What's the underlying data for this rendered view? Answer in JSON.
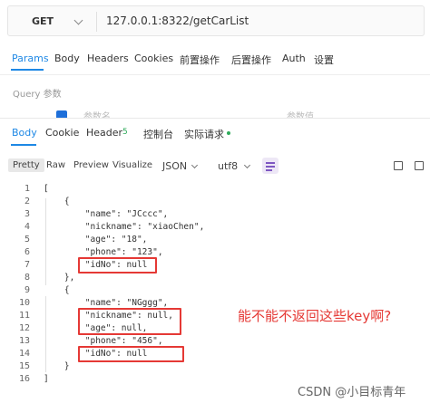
{
  "request": {
    "method": "GET",
    "url": "127.0.0.1:8322/getCarList"
  },
  "request_tabs": [
    "Params",
    "Body",
    "Headers",
    "Cookies",
    "前置操作",
    "后置操作",
    "Auth",
    "设置"
  ],
  "query_label": "Query 参数",
  "params_placeholders": {
    "name": "参数名",
    "value": "参数值"
  },
  "response_tabs": {
    "body": "Body",
    "cookie": "Cookie",
    "header": "Header",
    "header_count": "5",
    "console": "控制台",
    "actual_request": "实际请求"
  },
  "toolbar": {
    "pretty": "Pretty",
    "raw": "Raw",
    "preview": "Preview",
    "visualize": "Visualize",
    "format": "JSON",
    "encoding": "utf8"
  },
  "code_lines": [
    "[",
    "    {",
    "        \"name\": \"JCccc\",",
    "        \"nickname\": \"xiaoChen\",",
    "        \"age\": \"18\",",
    "        \"phone\": \"123\",",
    "        \"idNo\": null",
    "    },",
    "    {",
    "        \"name\": \"NGggg\",",
    "        \"nickname\": null,",
    "        \"age\": null,",
    "        \"phone\": \"456\",",
    "        \"idNo\": null",
    "    }",
    "]"
  ],
  "line_numbers": [
    "1",
    "2",
    "3",
    "4",
    "5",
    "6",
    "7",
    "8",
    "9",
    "10",
    "11",
    "12",
    "13",
    "14",
    "15",
    "16"
  ],
  "annotation": "能不能不返回这些key啊?",
  "watermark": "CSDN @小目标青年",
  "colors": {
    "accent": "#1e88e5",
    "highlight": "#e53935",
    "success": "#2eaa5a"
  }
}
